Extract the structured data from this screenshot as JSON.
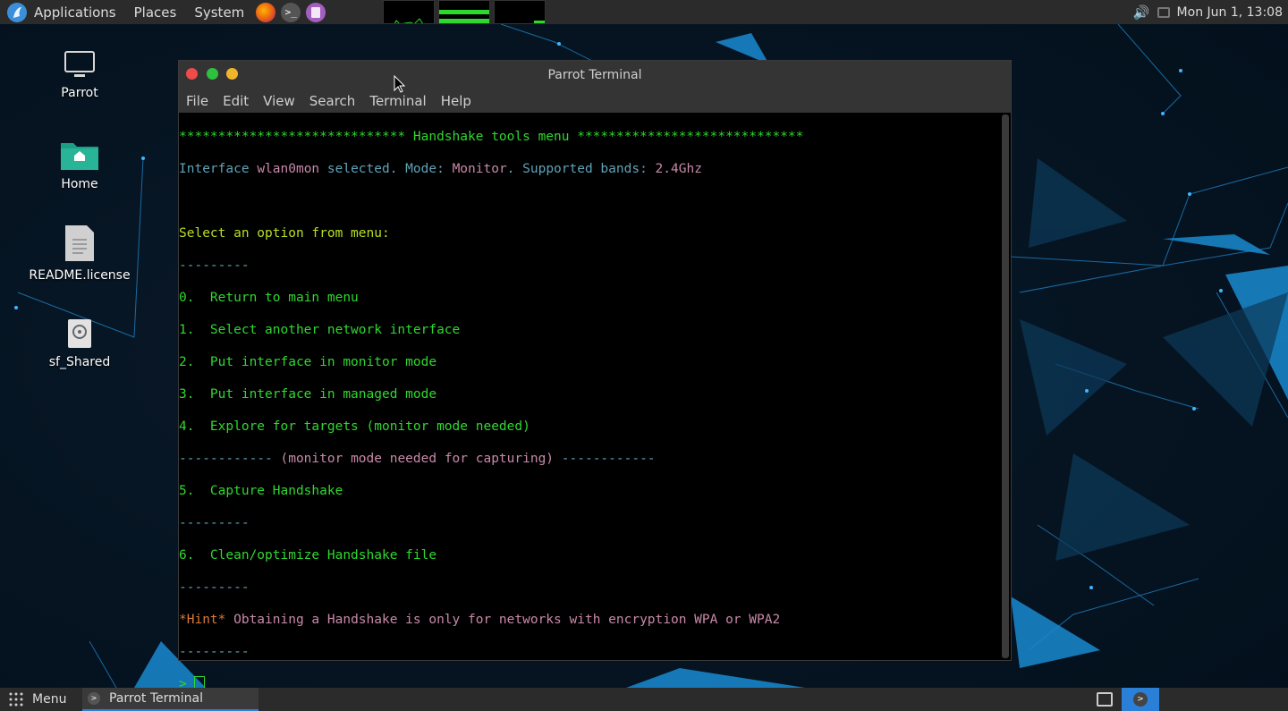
{
  "top_panel": {
    "menus": [
      "Applications",
      "Places",
      "System"
    ],
    "launchers": [
      "firefox-icon",
      "terminal-icon",
      "text-editor-icon"
    ],
    "clock": "Mon Jun 1, 13:08"
  },
  "desktop_icons": [
    {
      "label": "Parrot",
      "icon": "computer-icon"
    },
    {
      "label": "Home",
      "icon": "home-folder-icon"
    },
    {
      "label": "README.license",
      "icon": "text-file-icon"
    },
    {
      "label": "sf_Shared",
      "icon": "drive-icon"
    }
  ],
  "terminal": {
    "title": "Parrot Terminal",
    "menu": [
      "File",
      "Edit",
      "View",
      "Search",
      "Terminal",
      "Help"
    ],
    "lines": {
      "header": "***************************** Handshake tools menu *****************************",
      "iface_a": "Interface ",
      "iface_b": "wlan0mon",
      "iface_c": " selected. Mode: ",
      "iface_d": "Monitor",
      "iface_e": ". Supported bands: ",
      "iface_f": "2.4Ghz",
      "select": "Select an option from menu:",
      "sep": "---------",
      "opt0": "0.  Return to main menu",
      "opt1": "1.  Select another network interface",
      "opt2": "2.  Put interface in monitor mode",
      "opt3": "3.  Put interface in managed mode",
      "opt4": "4.  Explore for targets (monitor mode needed)",
      "cap_a": "------------",
      "cap_b": " (monitor mode needed for capturing) ",
      "cap_c": "------------",
      "opt5": "5.  Capture Handshake",
      "opt6": "6.  Clean/optimize Handshake file",
      "hint_a": "*Hint*",
      "hint_b": " Obtaining a Handshake is only for networks with encryption WPA or WPA2",
      "prompt": "> "
    }
  },
  "bottom_panel": {
    "menu_label": "Menu",
    "task_label": "Parrot Terminal"
  },
  "colors": {
    "term_green": "#2fd82f",
    "term_cyan": "#5fa3b8",
    "term_pink": "#c889a8",
    "accent_blue": "#2a7fd6"
  }
}
